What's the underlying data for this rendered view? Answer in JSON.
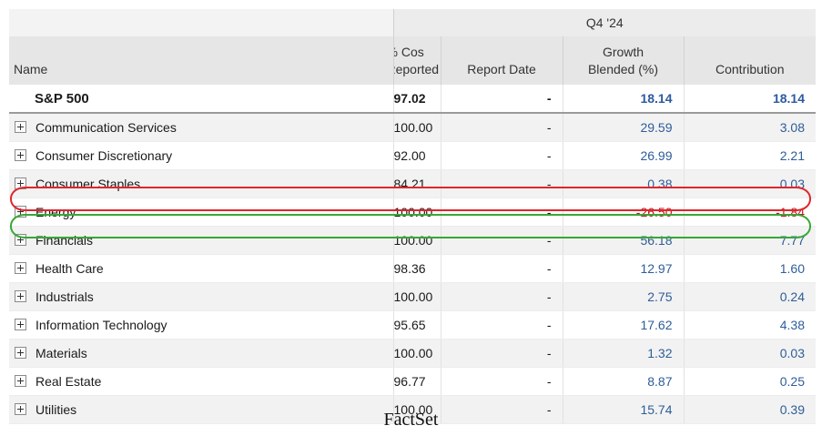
{
  "header": {
    "quarter": "Q4 '24",
    "col_name": "Name",
    "col_cos_line1": "% Cos",
    "col_cos_line2": "Reported",
    "col_report": "Report Date",
    "col_growth_line1": "Growth",
    "col_growth_line2": "Blended (%)",
    "col_contrib": "Contribution"
  },
  "total": {
    "name": "S&P 500",
    "cos": "97.02",
    "report": "-",
    "growth": "18.14",
    "contrib": "18.14"
  },
  "rows": [
    {
      "name": "Communication Services",
      "cos": "100.00",
      "report": "-",
      "growth": "29.59",
      "contrib": "3.08"
    },
    {
      "name": "Consumer Discretionary",
      "cos": "92.00",
      "report": "-",
      "growth": "26.99",
      "contrib": "2.21"
    },
    {
      "name": "Consumer Staples",
      "cos": "84.21",
      "report": "-",
      "growth": "0.38",
      "contrib": "0.03"
    },
    {
      "name": "Energy",
      "cos": "100.00",
      "report": "-",
      "growth": "-26.50",
      "contrib": "-1.84"
    },
    {
      "name": "Financials",
      "cos": "100.00",
      "report": "-",
      "growth": "56.18",
      "contrib": "7.77"
    },
    {
      "name": "Health Care",
      "cos": "98.36",
      "report": "-",
      "growth": "12.97",
      "contrib": "1.60"
    },
    {
      "name": "Industrials",
      "cos": "100.00",
      "report": "-",
      "growth": "2.75",
      "contrib": "0.24"
    },
    {
      "name": "Information Technology",
      "cos": "95.65",
      "report": "-",
      "growth": "17.62",
      "contrib": "4.38"
    },
    {
      "name": "Materials",
      "cos": "100.00",
      "report": "-",
      "growth": "1.32",
      "contrib": "0.03"
    },
    {
      "name": "Real Estate",
      "cos": "96.77",
      "report": "-",
      "growth": "8.87",
      "contrib": "0.25"
    },
    {
      "name": "Utilities",
      "cos": "100.00",
      "report": "-",
      "growth": "15.74",
      "contrib": "0.39"
    }
  ],
  "icons": {
    "expand": "plus-box-icon"
  },
  "colors": {
    "positive": "#2e5d99",
    "negative": "#c0171b",
    "highlight_red": "#e0252b",
    "highlight_green": "#3aa637"
  },
  "source": "FactSet"
}
